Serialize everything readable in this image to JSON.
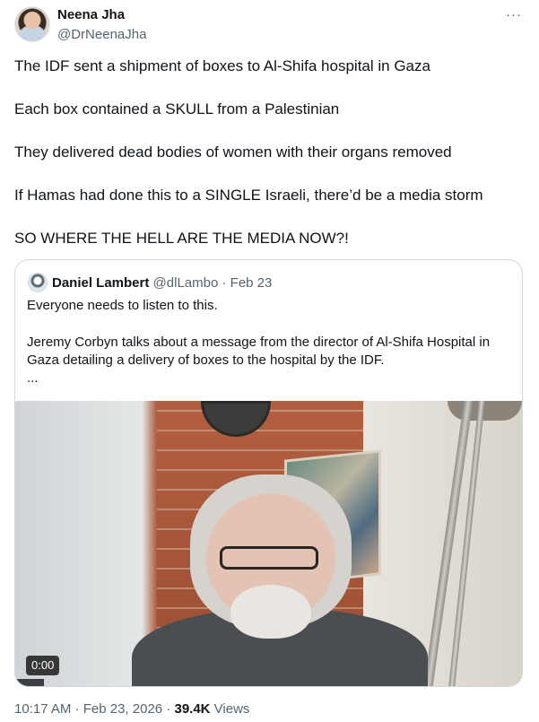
{
  "author": {
    "name": "Neena Jha",
    "handle": "@DrNeenaJha"
  },
  "tweet_lines": [
    "The IDF sent a shipment of boxes to Al-Shifa hospital in Gaza",
    "Each box contained a SKULL from a Palestinian",
    "They delivered dead bodies of women with their organs removed",
    "If Hamas had done this to a SINGLE Israeli, there’d be a media storm",
    "SO WHERE THE HELL ARE THE MEDIA NOW?!"
  ],
  "more_label": "···",
  "quote": {
    "name": "Daniel Lambert",
    "handle": "@dlLambo",
    "sep": " · ",
    "date": "Feb 23",
    "lines": [
      "Everyone needs to listen to this.",
      "Jeremy Corbyn talks about a message from the director of Al-Shifa Hospital in",
      "Gaza detailing a delivery of boxes to the hospital by the IDF.",
      "..."
    ],
    "video_time": "0:00"
  },
  "footer": {
    "time": "10:17 AM",
    "sep1": " · ",
    "date": "Feb 23, 2026",
    "sep2": " · ",
    "views_count": "39.4K",
    "views_label": " Views"
  }
}
